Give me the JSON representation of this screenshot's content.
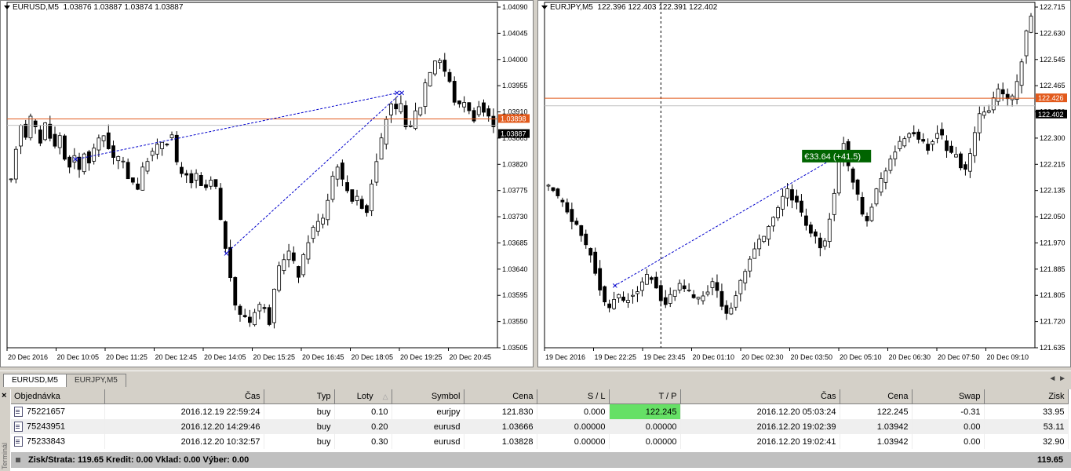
{
  "charts": [
    {
      "title": "EURUSD,M5",
      "ohlc": "1.03876 1.03887 1.03874 1.03887",
      "price_min": 1.03505,
      "price_max": 1.0409,
      "y_ticks": [
        "1.04090",
        "1.04045",
        "1.04000",
        "1.03955",
        "1.03910",
        "1.03865",
        "1.03820",
        "1.03775",
        "1.03730",
        "1.03685",
        "1.03640",
        "1.03595",
        "1.03550",
        "1.03505"
      ],
      "x_ticks": [
        "20 Dec 2016",
        "20 Dec 10:05",
        "20 Dec 11:25",
        "20 Dec 12:45",
        "20 Dec 14:05",
        "20 Dec 15:25",
        "20 Dec 16:45",
        "20 Dec 18:05",
        "20 Dec 19:25",
        "20 Dec 20:45"
      ],
      "ask_label": "1.03898",
      "bid_label": "1.03887",
      "ask_value": 1.03898,
      "bid_value": 1.03887,
      "trades": [
        {
          "open_bar": 13,
          "open": 1.03828,
          "close_bar": 79,
          "close": 1.03942
        },
        {
          "open_bar": 44,
          "open": 1.03666,
          "close_bar": 80,
          "close": 1.03942
        }
      ],
      "path": [
        1.0379,
        1.0385,
        1.0389,
        1.0387,
        1.039,
        1.0388,
        1.0386,
        1.0389,
        1.0387,
        1.0385,
        1.0387,
        1.0383,
        1.0382,
        1.0383,
        1.0381,
        1.0384,
        1.0382,
        1.0385,
        1.0386,
        1.0387,
        1.0385,
        1.0383,
        1.0383,
        1.0382,
        1.038,
        1.0379,
        1.0378,
        1.0381,
        1.0383,
        1.0384,
        1.0385,
        1.0386,
        1.0386,
        1.0387,
        1.0382,
        1.038,
        1.038,
        1.0379,
        1.038,
        1.0378,
        1.0378,
        1.0379,
        1.0378,
        1.0372,
        1.0368,
        1.0362,
        1.0358,
        1.0356,
        1.0356,
        1.0355,
        1.0357,
        1.0358,
        1.0357,
        1.0355,
        1.036,
        1.0364,
        1.0366,
        1.0367,
        1.0365,
        1.0363,
        1.0366,
        1.0369,
        1.0371,
        1.0372,
        1.0373,
        1.0376,
        1.038,
        1.0382,
        1.0379,
        1.0378,
        1.0376,
        1.0376,
        1.0375,
        1.0374,
        1.0379,
        1.0383,
        1.0386,
        1.039,
        1.0392,
        1.0391,
        1.0392,
        1.0389,
        1.0388,
        1.0391,
        1.0392,
        1.0396,
        1.0398,
        1.04,
        1.04,
        1.0398,
        1.0396,
        1.0393,
        1.0392,
        1.0393,
        1.0391,
        1.039,
        1.0392,
        1.0391,
        1.039,
        1.0389
      ]
    },
    {
      "title": "EURJPY,M5",
      "ohlc": "122.396 122.403 122.391 122.402",
      "price_min": 121.635,
      "price_max": 122.715,
      "y_ticks": [
        "122.715",
        "122.630",
        "122.545",
        "122.465",
        "122.380",
        "122.300",
        "122.215",
        "122.135",
        "122.050",
        "121.970",
        "121.885",
        "121.805",
        "121.720",
        "121.635"
      ],
      "x_ticks": [
        "19 Dec 2016",
        "19 Dec 22:25",
        "19 Dec 23:45",
        "20 Dec 01:10",
        "20 Dec 02:30",
        "20 Dec 03:50",
        "20 Dec 05:10",
        "20 Dec 06:30",
        "20 Dec 07:50",
        "20 Dec 09:10"
      ],
      "ask_label": "122.426",
      "bid_label": "122.402",
      "ask_value": 122.426,
      "bid_value": 122.402,
      "trade_label": "€33.64 (+41.5)",
      "trades": [
        {
          "open_bar": 14,
          "open": 121.83,
          "close_bar": 62,
          "close": 122.245
        }
      ],
      "vline_bar": 24,
      "path": [
        122.14,
        122.13,
        122.11,
        122.09,
        122.07,
        122.04,
        122.02,
        121.99,
        121.96,
        121.93,
        121.88,
        121.82,
        121.78,
        121.76,
        121.79,
        121.8,
        121.78,
        121.79,
        121.8,
        121.82,
        121.84,
        121.86,
        121.85,
        121.83,
        121.79,
        121.77,
        121.8,
        121.82,
        121.83,
        121.82,
        121.81,
        121.8,
        121.79,
        121.8,
        121.82,
        121.84,
        121.81,
        121.77,
        121.75,
        121.76,
        121.8,
        121.84,
        121.88,
        121.92,
        121.95,
        121.97,
        121.99,
        122.02,
        122.04,
        122.08,
        122.11,
        122.13,
        122.11,
        122.09,
        122.06,
        122.03,
        122.0,
        121.98,
        121.96,
        121.98,
        122.05,
        122.12,
        122.24,
        122.29,
        122.21,
        122.17,
        122.12,
        122.06,
        122.04,
        122.09,
        122.13,
        122.17,
        122.2,
        122.23,
        122.26,
        122.28,
        122.3,
        122.32,
        122.31,
        122.29,
        122.28,
        122.27,
        122.29,
        122.32,
        122.3,
        122.27,
        122.25,
        122.24,
        122.21,
        122.19,
        122.25,
        122.31,
        122.37,
        122.38,
        122.39,
        122.42,
        122.45,
        122.44,
        122.42,
        122.43,
        122.47,
        122.55,
        122.63,
        122.69
      ]
    }
  ],
  "tabs": {
    "active": "EURUSD,M5",
    "inactive": "EURJPY,M5"
  },
  "orders_header": [
    "Objednávka",
    "Čas",
    "Typ",
    "Loty",
    "Symbol",
    "Cena",
    "S / L",
    "T / P",
    "Čas",
    "Cena",
    "Swap",
    "Zisk"
  ],
  "orders": [
    [
      "75221657",
      "2016.12.19 22:59:24",
      "buy",
      "0.10",
      "eurjpy",
      "121.830",
      "0.000",
      "122.245",
      "2016.12.20 05:03:24",
      "122.245",
      "-0.31",
      "33.95"
    ],
    [
      "75243951",
      "2016.12.20 14:29:46",
      "buy",
      "0.20",
      "eurusd",
      "1.03666",
      "0.00000",
      "0.00000",
      "2016.12.20 19:02:39",
      "1.03942",
      "0.00",
      "53.11"
    ],
    [
      "75233843",
      "2016.12.20 10:32:57",
      "buy",
      "0.30",
      "eurusd",
      "1.03828",
      "0.00000",
      "0.00000",
      "2016.12.20 19:02:41",
      "1.03942",
      "0.00",
      "32.90"
    ]
  ],
  "summary": {
    "text": "Zisk/Strata: 119.65  Kredit: 0.00  Vklad: 0.00  Výber: 0.00",
    "total": "119.65"
  },
  "terminal_label": "Terminál",
  "colors": {
    "ask_line": "#e25a1c",
    "bid_line": "#c0c0c0",
    "trade_line": "#0000cc",
    "trade_badge": "#006400",
    "tp_hit": "#66e066"
  }
}
